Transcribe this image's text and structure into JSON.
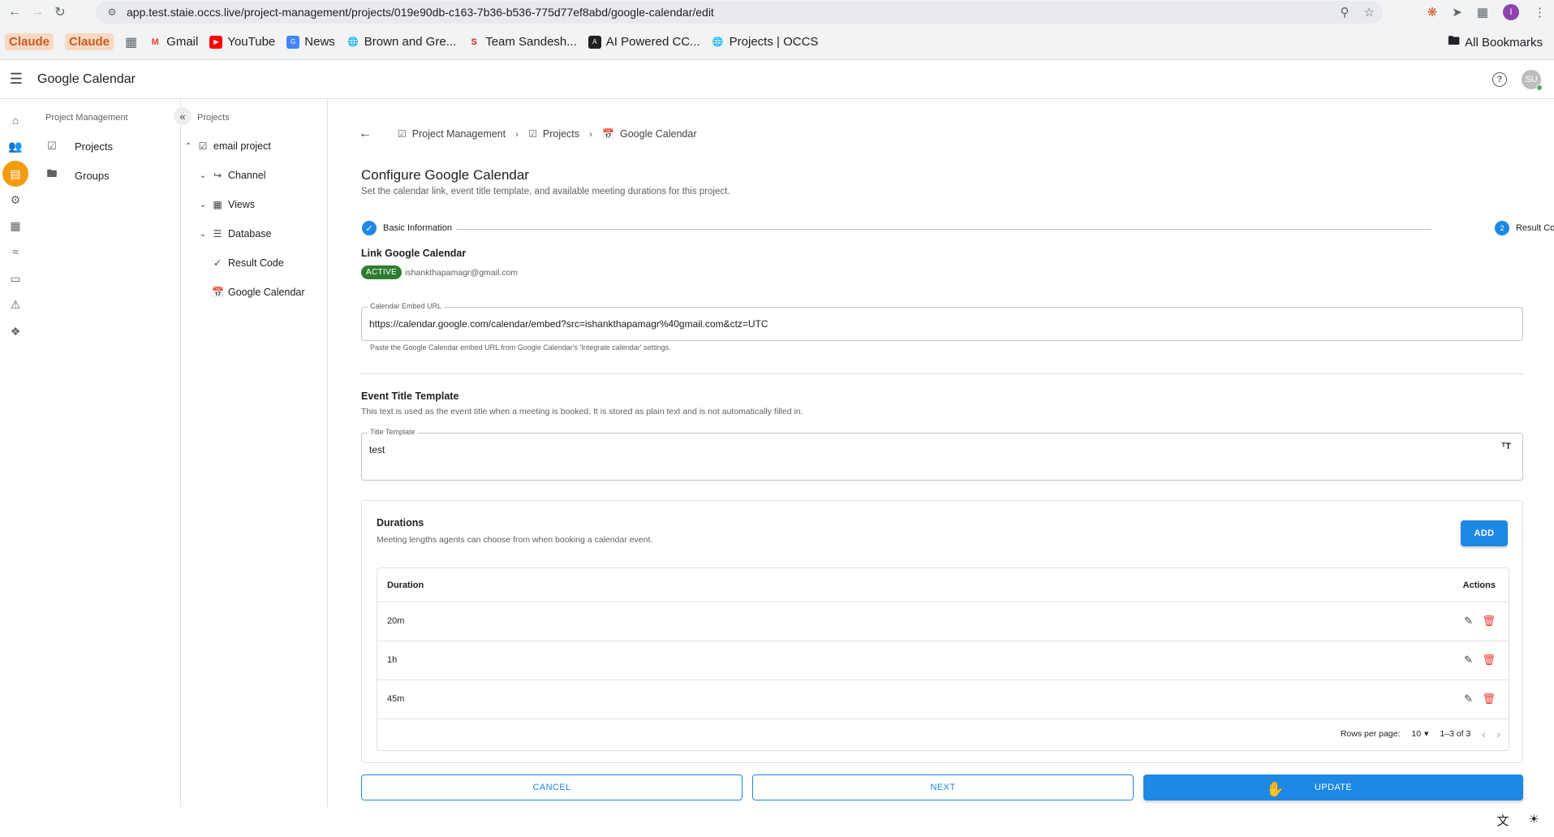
{
  "browser": {
    "url": "app.test.staie.occs.live/project-management/projects/019e90db-c163-7b36-b536-775d77ef8abd/google-calendar/edit",
    "profile_initial": "I",
    "bookmarks": [
      {
        "label": "Claude",
        "icon": "claude-icon"
      },
      {
        "label": "Claude",
        "icon": "claude-icon"
      },
      {
        "label": "Gmail",
        "icon": "gmail-icon"
      },
      {
        "label": "YouTube",
        "icon": "youtube-icon"
      },
      {
        "label": "News",
        "icon": "news-icon"
      },
      {
        "label": "Brown and Gre...",
        "icon": "globe-icon"
      },
      {
        "label": "Team Sandesh...",
        "icon": "team-icon"
      },
      {
        "label": "AI Powered CC...",
        "icon": "ai-icon"
      },
      {
        "label": "Projects | OCCS",
        "icon": "globe-icon"
      }
    ],
    "all_bookmarks": "All Bookmarks"
  },
  "header": {
    "title": "Google Calendar",
    "avatar_initials": "SU"
  },
  "subnav": {
    "title": "Project Management",
    "items": [
      {
        "label": "Projects",
        "icon": "checkbox-icon"
      },
      {
        "label": "Groups",
        "icon": "folder-icon"
      }
    ]
  },
  "tree": {
    "title": "Projects",
    "project": "email project",
    "children": [
      {
        "label": "Channel",
        "icon": "channel-icon"
      },
      {
        "label": "Views",
        "icon": "grid-icon"
      },
      {
        "label": "Database",
        "icon": "database-icon"
      },
      {
        "label": "Result Code",
        "icon": "check-icon"
      },
      {
        "label": "Google Calendar",
        "icon": "calendar-icon"
      }
    ]
  },
  "breadcrumb": [
    {
      "label": "Project Management"
    },
    {
      "label": "Projects"
    },
    {
      "label": "Google Calendar"
    }
  ],
  "page": {
    "title": "Configure Google Calendar",
    "subtitle": "Set the calendar link, event title template, and available meeting durations for this project."
  },
  "stepper": {
    "step1": "Basic Information",
    "step2_num": "2",
    "step2": "Result Codes"
  },
  "link_section": {
    "title": "Link Google Calendar",
    "status": "ACTIVE",
    "email": "ishankthapamagr@gmail.com",
    "embed_label": "Calendar Embed URL",
    "embed_value": "https://calendar.google.com/calendar/embed?src=ishankthapamagr%40gmail.com&ctz=UTC",
    "embed_helper": "Paste the Google Calendar embed URL from Google Calendar's 'Integrate calendar' settings."
  },
  "title_section": {
    "title": "Event Title Template",
    "desc": "This text is used as the event title when a meeting is booked. It is stored as plain text and is not automatically filled in.",
    "field_label": "Title Template",
    "field_value": "test"
  },
  "durations": {
    "title": "Durations",
    "desc": "Meeting lengths agents can choose from when booking a calendar event.",
    "add_label": "ADD",
    "col_duration": "Duration",
    "col_actions": "Actions",
    "rows": [
      "20m",
      "1h",
      "45m"
    ],
    "rows_per_page_label": "Rows per page:",
    "rows_per_page": "10",
    "range": "1–3 of 3"
  },
  "actions": {
    "cancel": "CANCEL",
    "next": "NEXT",
    "update": "UPDATE"
  },
  "colors": {
    "primary": "#1e88e5",
    "active_rail": "#f39c12",
    "active_badge": "#2e7d32",
    "delete": "#e53935"
  }
}
